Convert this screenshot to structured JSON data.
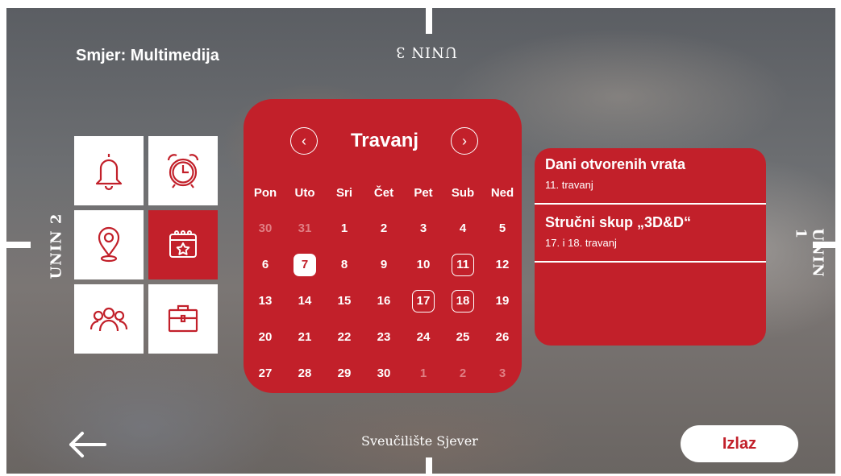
{
  "header": {
    "department": "Smjer: Multimedija",
    "top_label": "UNIN 3"
  },
  "side_labels": {
    "left": "UNIN 2",
    "right": "UNIN 1"
  },
  "footer": {
    "university": "Sveučilište Sjever"
  },
  "menu_tiles": [
    {
      "icon": "bell-icon",
      "active": false
    },
    {
      "icon": "alarm-clock-icon",
      "active": false
    },
    {
      "icon": "location-pin-icon",
      "active": false
    },
    {
      "icon": "calendar-star-icon",
      "active": true
    },
    {
      "icon": "people-group-icon",
      "active": false
    },
    {
      "icon": "briefcase-icon",
      "active": false
    }
  ],
  "calendar": {
    "month": "Travanj",
    "prev_icon": "chevron-left-icon",
    "next_icon": "chevron-right-icon",
    "weekdays": [
      "Pon",
      "Uto",
      "Sri",
      "Čet",
      "Pet",
      "Sub",
      "Ned"
    ],
    "weeks": [
      [
        {
          "d": "30",
          "m": true
        },
        {
          "d": "31",
          "m": true
        },
        {
          "d": "1"
        },
        {
          "d": "2"
        },
        {
          "d": "3"
        },
        {
          "d": "4"
        },
        {
          "d": "5"
        }
      ],
      [
        {
          "d": "6"
        },
        {
          "d": "7",
          "today": true
        },
        {
          "d": "8"
        },
        {
          "d": "9"
        },
        {
          "d": "10"
        },
        {
          "d": "11",
          "event": true
        },
        {
          "d": "12"
        }
      ],
      [
        {
          "d": "13"
        },
        {
          "d": "14"
        },
        {
          "d": "15"
        },
        {
          "d": "16"
        },
        {
          "d": "17",
          "event": true
        },
        {
          "d": "18",
          "event": true
        },
        {
          "d": "19"
        }
      ],
      [
        {
          "d": "20"
        },
        {
          "d": "21"
        },
        {
          "d": "22"
        },
        {
          "d": "23"
        },
        {
          "d": "24"
        },
        {
          "d": "25"
        },
        {
          "d": "26"
        }
      ],
      [
        {
          "d": "27"
        },
        {
          "d": "28"
        },
        {
          "d": "29"
        },
        {
          "d": "30"
        },
        {
          "d": "1",
          "m": true
        },
        {
          "d": "2",
          "m": true
        },
        {
          "d": "3",
          "m": true
        }
      ]
    ]
  },
  "events": [
    {
      "title": "Dani otvorenih vrata",
      "date": "11. travanj"
    },
    {
      "title": "Stručni skup „3D&D“",
      "date": "17. i 18. travanj"
    }
  ],
  "nav": {
    "back_icon": "arrow-left-icon",
    "exit_label": "Izlaz"
  },
  "colors": {
    "accent": "#c2202a",
    "muted_day": "#e07e83",
    "tile_bg": "#ffffff"
  }
}
